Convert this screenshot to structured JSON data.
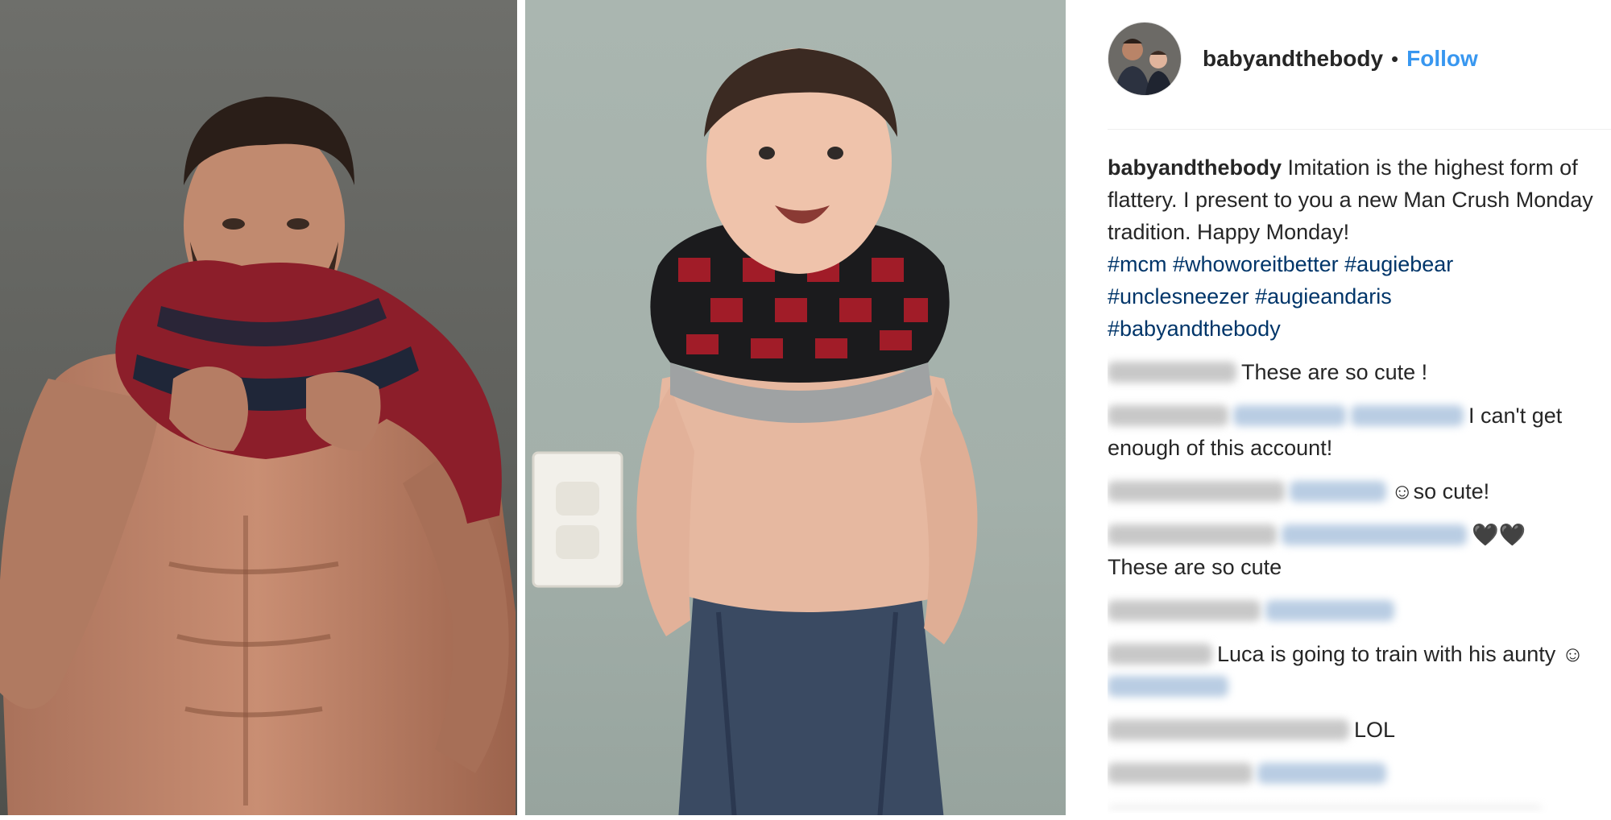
{
  "post": {
    "username": "babyandthebody",
    "separator": "•",
    "follow_label": "Follow"
  },
  "caption": {
    "username": "babyandthebody",
    "text": "Imitation is the highest form of flattery. I present to you a new Man Crush Monday tradition. Happy Monday!",
    "hashtags": [
      "#mcm",
      "#whoworeitbetter",
      "#augiebear",
      "#unclesneezer",
      "#augieandaris",
      "#babyandthebody"
    ]
  },
  "comments": [
    {
      "text": "These are so cute !"
    },
    {
      "text": "I can't get enough of this account!"
    },
    {
      "text": "so cute!"
    },
    {
      "text": "These are so cute"
    },
    {
      "text": "Luca is going to train with his aunty"
    },
    {
      "text": "LOL"
    }
  ],
  "icons": {
    "avatar": "avatar-photo",
    "smiley": "smiling-face-emoji",
    "hearts": "black-heart-emoji"
  },
  "colors": {
    "link_blue": "#3897f0",
    "hashtag_blue": "#003569",
    "text": "#262626"
  }
}
